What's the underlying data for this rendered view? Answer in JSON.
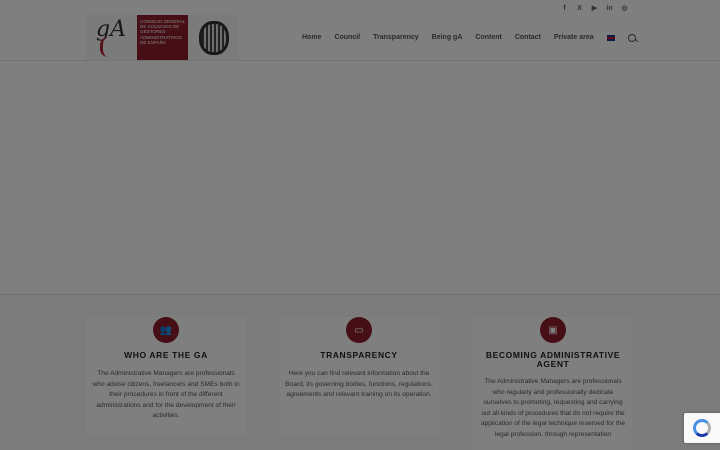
{
  "social": [
    "f",
    "X",
    "▶",
    "in",
    "◎"
  ],
  "logo": {
    "monogram": "gA",
    "text": "Consejo General de Colegios de Gestores Administrativos de España"
  },
  "nav": {
    "items": [
      "Home",
      "Council",
      "Transparency",
      "Being gA",
      "Content",
      "Contact",
      "Private area"
    ]
  },
  "features": [
    {
      "icon": "group-icon",
      "title": "WHO ARE THE GA",
      "text": "The Administrative Managers are professionals who advise citizens, freelancers and SMEs both in their procedures in front of the different administrations and for the development of their activities."
    },
    {
      "icon": "monitor-icon",
      "title": "TRANSPARENCY",
      "text": "Here you can find relevant information about the Board, its governing bodies, functions, regulations, agreements and relevant training on its operation."
    },
    {
      "icon": "briefcase-icon",
      "title": "BECOMING ADMINISTRATIVE AGENT",
      "text": "The Administrative Managers are professionals who regularly and professionally dedicate ourselves to promoting, requesting and carrying out all kinds of procedures that do not require the application of the legal technique reserved for the legal profession, through representation"
    }
  ],
  "colors": {
    "accent": "#8c1d2b"
  }
}
